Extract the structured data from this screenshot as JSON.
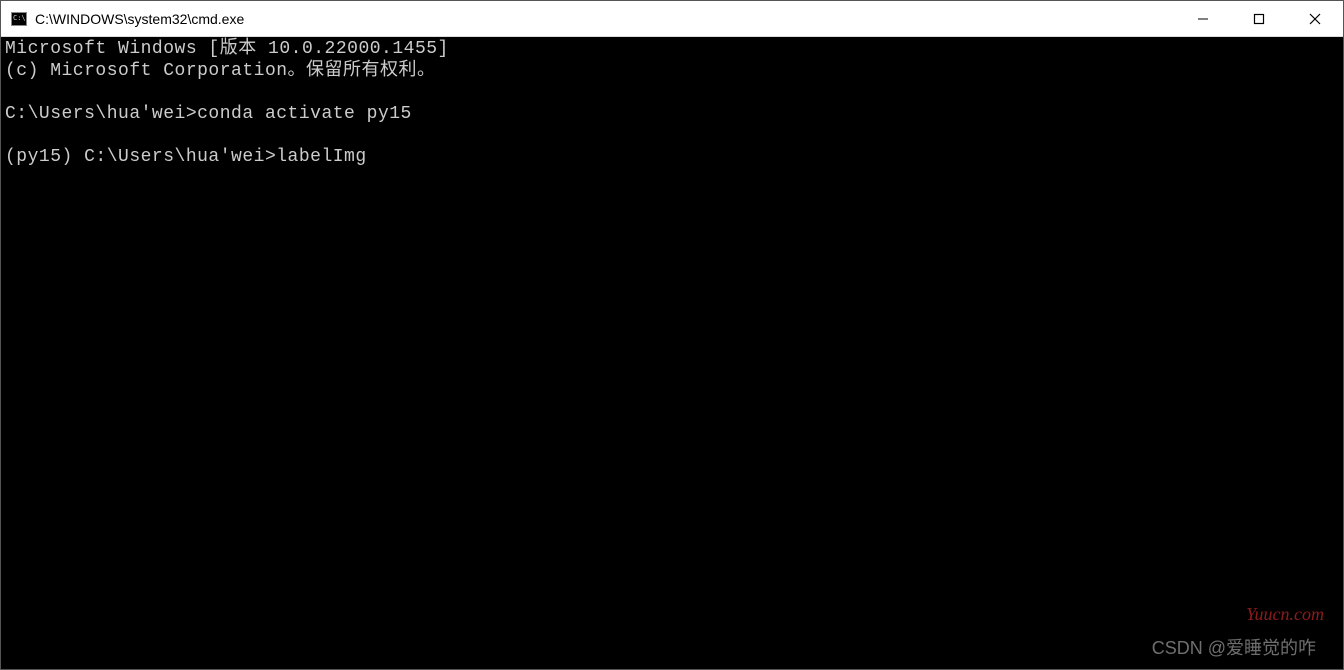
{
  "window": {
    "title": "C:\\WINDOWS\\system32\\cmd.exe"
  },
  "terminal": {
    "lines": [
      "Microsoft Windows [版本 10.0.22000.1455]",
      "(c) Microsoft Corporation。保留所有权利。",
      "",
      "C:\\Users\\hua'wei>conda activate py15",
      "",
      "(py15) C:\\Users\\hua'wei>labelImg"
    ]
  },
  "watermarks": {
    "csdn": "CSDN @爱睡觉的咋",
    "yuucn": "Yuucn.com"
  }
}
